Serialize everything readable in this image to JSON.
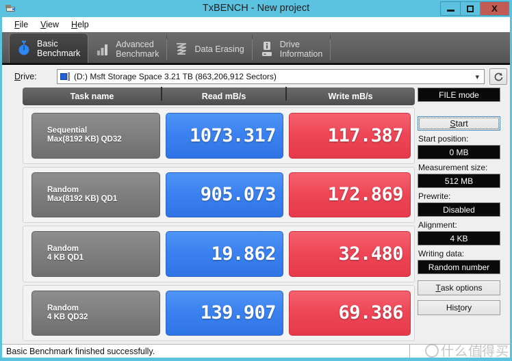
{
  "window": {
    "title": "TxBENCH - New project",
    "app_icon": "usb-drive-icon",
    "buttons": {
      "minimize": "minimize-icon",
      "maximize": "maximize-icon",
      "close": "X"
    }
  },
  "menubar": {
    "items": [
      {
        "label": "File",
        "mnemonic": "F"
      },
      {
        "label": "View",
        "mnemonic": "V"
      },
      {
        "label": "Help",
        "mnemonic": "H"
      }
    ]
  },
  "tabs": [
    {
      "label": "Basic\nBenchmark",
      "icon": "stopwatch-icon",
      "active": true
    },
    {
      "label": "Advanced\nBenchmark",
      "icon": "bar-chart-icon",
      "active": false
    },
    {
      "label": "Data Erasing",
      "icon": "shredder-icon",
      "active": false
    },
    {
      "label": "Drive\nInformation",
      "icon": "drive-info-icon",
      "active": false
    }
  ],
  "drive": {
    "label": "Drive:",
    "value": "(D:) Msft Storage Space  3.21 TB (863,206,912 Sectors)",
    "caret": "⌄",
    "refresh_icon": "refresh-icon"
  },
  "results": {
    "columns": [
      "Task name",
      "Read mB/s",
      "Write mB/s"
    ],
    "rows": [
      {
        "task": "Sequential\nMax(8192 KB) QD32",
        "read": "1073.317",
        "write": "117.387"
      },
      {
        "task": "Random\nMax(8192 KB) QD1",
        "read": "905.073",
        "write": "172.869"
      },
      {
        "task": "Random\n4 KB QD1",
        "read": "19.862",
        "write": "32.480"
      },
      {
        "task": "Random\n4 KB QD32",
        "read": "139.907",
        "write": "69.386"
      }
    ]
  },
  "sidebar": {
    "mode_button": "FILE mode",
    "start_button": "Start",
    "start_position_label": "Start position:",
    "start_position_value": "0 MB",
    "measurement_size_label": "Measurement size:",
    "measurement_size_value": "512 MB",
    "prewrite_label": "Prewrite:",
    "prewrite_value": "Disabled",
    "alignment_label": "Alignment:",
    "alignment_value": "4 KB",
    "writing_data_label": "Writing data:",
    "writing_data_value": "Random number",
    "task_options_button": "Task options",
    "history_button": "History"
  },
  "statusbar": {
    "message": "Basic Benchmark finished successfully."
  },
  "watermark": {
    "text": "什么值得买"
  },
  "colors": {
    "titlebar": "#5bc3e0",
    "read_value": "#3b82f0",
    "write_value": "#ee4656",
    "tabbar": "#636363",
    "body": "#efefef",
    "close_button": "#c25b53"
  }
}
